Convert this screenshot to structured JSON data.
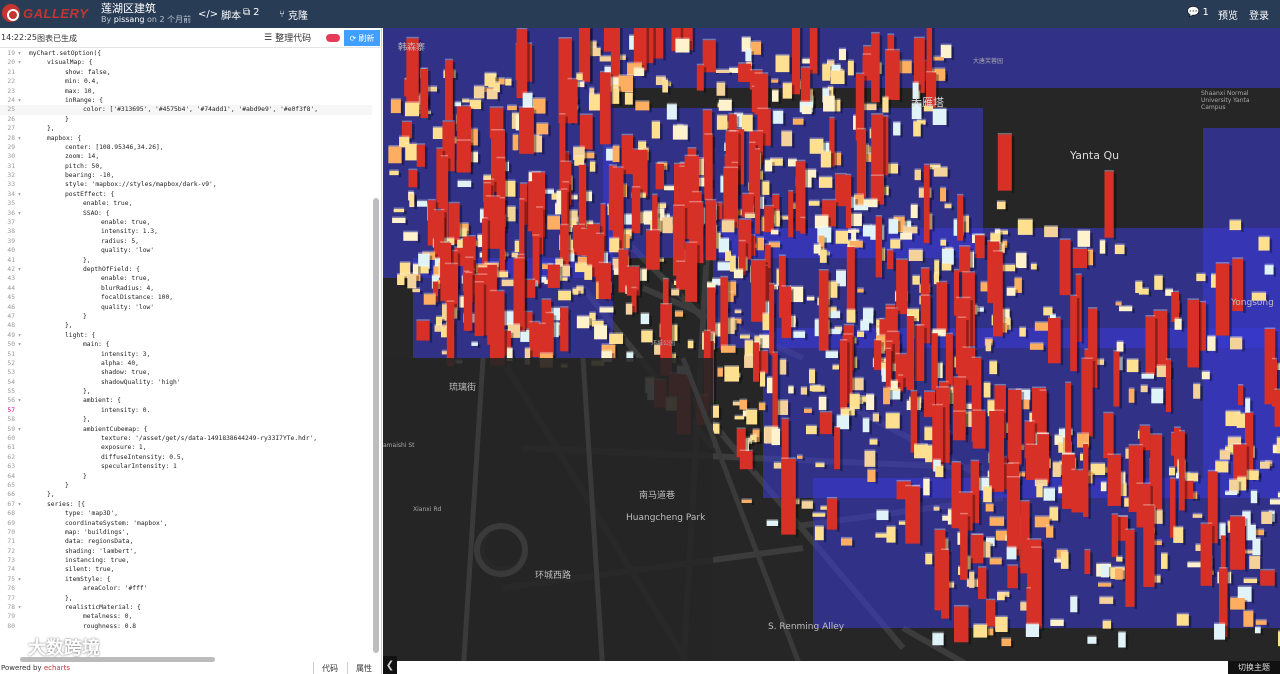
{
  "header": {
    "logo": "GALLERY",
    "title": "莲湖区建筑",
    "byline_prefix": "By",
    "author": "pissang",
    "byline_suffix": "on 2 个月前",
    "script_label": "脚本",
    "count": "2",
    "fork_label": "克隆",
    "comments": "1",
    "preview_label": "预览",
    "login_label": "登录"
  },
  "editor": {
    "time": "14:22:25",
    "status": "图表已生成",
    "format_label": "整理代码",
    "run_label": "刷新",
    "powered_prefix": "Powered by",
    "powered_brand": "echarts",
    "tab_code": "代码",
    "tab_props": "属性",
    "watermark": "大数跨境",
    "lines": [
      {
        "n": "19",
        "f": "▾",
        "t": "myChart.setOption({",
        "i": 0
      },
      {
        "n": "20",
        "f": "▾",
        "t": "visualMap: {",
        "i": 1
      },
      {
        "n": "21",
        "f": "",
        "t": "show: false,",
        "i": 2
      },
      {
        "n": "22",
        "f": "",
        "t": "min: 0.4,",
        "i": 2
      },
      {
        "n": "23",
        "f": "",
        "t": "max: 10,",
        "i": 2
      },
      {
        "n": "24",
        "f": "▾",
        "t": "inRange: {",
        "i": 2
      },
      {
        "n": "25",
        "f": "",
        "t": "color: ['#313695', '#4575b4', '#74add1', '#abd9e9', '#e0f3f8',",
        "i": 3,
        "hl": true
      },
      {
        "n": "26",
        "f": "",
        "t": "}",
        "i": 2
      },
      {
        "n": "27",
        "f": "",
        "t": "},",
        "i": 1
      },
      {
        "n": "28",
        "f": "▾",
        "t": "mapbox: {",
        "i": 1
      },
      {
        "n": "29",
        "f": "",
        "t": "center: [108.95346,34.26],",
        "i": 2
      },
      {
        "n": "30",
        "f": "",
        "t": "zoom: 14,",
        "i": 2
      },
      {
        "n": "31",
        "f": "",
        "t": "pitch: 50,",
        "i": 2
      },
      {
        "n": "32",
        "f": "",
        "t": "bearing: -10,",
        "i": 2
      },
      {
        "n": "33",
        "f": "",
        "t": "style: 'mapbox://styles/mapbox/dark-v9',",
        "i": 2
      },
      {
        "n": "34",
        "f": "▾",
        "t": "postEffect: {",
        "i": 2
      },
      {
        "n": "35",
        "f": "",
        "t": "enable: true,",
        "i": 3
      },
      {
        "n": "36",
        "f": "▾",
        "t": "SSAO: {",
        "i": 3
      },
      {
        "n": "37",
        "f": "",
        "t": "enable: true,",
        "i": 4
      },
      {
        "n": "38",
        "f": "",
        "t": "intensity: 1.3,",
        "i": 4
      },
      {
        "n": "39",
        "f": "",
        "t": "radius: 5,",
        "i": 4
      },
      {
        "n": "40",
        "f": "",
        "t": "quality: 'low'",
        "i": 4
      },
      {
        "n": "41",
        "f": "",
        "t": "},",
        "i": 3
      },
      {
        "n": "42",
        "f": "▾",
        "t": "depthOfField: {",
        "i": 3
      },
      {
        "n": "43",
        "f": "",
        "t": "enable: true,",
        "i": 4
      },
      {
        "n": "44",
        "f": "",
        "t": "blurRadius: 4,",
        "i": 4
      },
      {
        "n": "45",
        "f": "",
        "t": "focalDistance: 100,",
        "i": 4
      },
      {
        "n": "46",
        "f": "",
        "t": "quality: 'low'",
        "i": 4
      },
      {
        "n": "47",
        "f": "",
        "t": "}",
        "i": 3
      },
      {
        "n": "48",
        "f": "",
        "t": "},",
        "i": 2
      },
      {
        "n": "49",
        "f": "▾",
        "t": "light: {",
        "i": 2
      },
      {
        "n": "50",
        "f": "▾",
        "t": "main: {",
        "i": 3
      },
      {
        "n": "51",
        "f": "",
        "t": "intensity: 3,",
        "i": 4
      },
      {
        "n": "52",
        "f": "",
        "t": "alpha: 40,",
        "i": 4
      },
      {
        "n": "53",
        "f": "",
        "t": "shadow: true,",
        "i": 4
      },
      {
        "n": "54",
        "f": "",
        "t": "shadowQuality: 'high'",
        "i": 4
      },
      {
        "n": "55",
        "f": "",
        "t": "},",
        "i": 3
      },
      {
        "n": "56",
        "f": "▾",
        "t": "ambient: {",
        "i": 3
      },
      {
        "n": "57",
        "f": "",
        "t": "intensity: 0.",
        "i": 4,
        "warn": true
      },
      {
        "n": "58",
        "f": "",
        "t": "},",
        "i": 3
      },
      {
        "n": "59",
        "f": "▾",
        "t": "ambientCubemap: {",
        "i": 3
      },
      {
        "n": "60",
        "f": "",
        "t": "texture: '/asset/get/s/data-1491838644249-ry33I7YTe.hdr',",
        "i": 4
      },
      {
        "n": "61",
        "f": "",
        "t": "exposure: 1,",
        "i": 4
      },
      {
        "n": "62",
        "f": "",
        "t": "diffuseIntensity: 0.5,",
        "i": 4
      },
      {
        "n": "63",
        "f": "",
        "t": "specularIntensity: 1",
        "i": 4
      },
      {
        "n": "64",
        "f": "",
        "t": "}",
        "i": 3
      },
      {
        "n": "65",
        "f": "",
        "t": "}",
        "i": 2
      },
      {
        "n": "66",
        "f": "",
        "t": "},",
        "i": 1
      },
      {
        "n": "67",
        "f": "▾",
        "t": "series: [{",
        "i": 1
      },
      {
        "n": "68",
        "f": "",
        "t": "type: 'map3D',",
        "i": 2
      },
      {
        "n": "69",
        "f": "",
        "t": "coordinateSystem: 'mapbox',",
        "i": 2
      },
      {
        "n": "70",
        "f": "",
        "t": "map: 'buildings',",
        "i": 2
      },
      {
        "n": "71",
        "f": "",
        "t": "data: regionsData,",
        "i": 2
      },
      {
        "n": "72",
        "f": "",
        "t": "shading: 'lambert',",
        "i": 2
      },
      {
        "n": "73",
        "f": "",
        "t": "instancing: true,",
        "i": 2
      },
      {
        "n": "74",
        "f": "",
        "t": "silent: true,",
        "i": 2
      },
      {
        "n": "75",
        "f": "▾",
        "t": "itemStyle: {",
        "i": 2
      },
      {
        "n": "76",
        "f": "",
        "t": "areaColor: '#fff'",
        "i": 3
      },
      {
        "n": "77",
        "f": "",
        "t": "},",
        "i": 2
      },
      {
        "n": "78",
        "f": "▾",
        "t": "realisticMaterial: {",
        "i": 2
      },
      {
        "n": "79",
        "f": "",
        "t": "metalness: 0,",
        "i": 3
      },
      {
        "n": "80",
        "f": "",
        "t": "roughness: 0.8",
        "i": 3
      }
    ]
  },
  "map": {
    "switch_label": "切换主题",
    "labels": [
      {
        "t": "韩森寨",
        "c": "lbl"
      },
      {
        "t": "大雁塔",
        "c": "lbl big"
      },
      {
        "t": "Yanta Qu",
        "c": "lbl big"
      },
      {
        "t": "Yongsong",
        "c": "lbl"
      },
      {
        "t": "环城公园",
        "c": "lbl sm"
      },
      {
        "t": "南马道巷",
        "c": "lbl"
      },
      {
        "t": "Huangcheng Park",
        "c": "lbl"
      },
      {
        "t": "环城西路",
        "c": "lbl"
      },
      {
        "t": "S. Renming Alley",
        "c": "lbl"
      },
      {
        "t": "琉璃街",
        "c": "lbl"
      },
      {
        "t": "amaishi St",
        "c": "lbl sm"
      },
      {
        "t": "Xianxi Rd",
        "c": "lbl sm"
      },
      {
        "t": "大唐芙蓉园",
        "c": "lbl sm"
      },
      {
        "t": "Shaanxi Normal University Yanta Campus",
        "c": "lbl sm"
      }
    ]
  },
  "colors": {
    "header": "#293c55",
    "brand": "#c23531",
    "run": "#409eff",
    "map_bg": "#262626",
    "water": "#3a3ad8",
    "tall": "#d73027",
    "mid": "#fdae61",
    "low": "#fee090",
    "pale": "#e0f3f8"
  }
}
